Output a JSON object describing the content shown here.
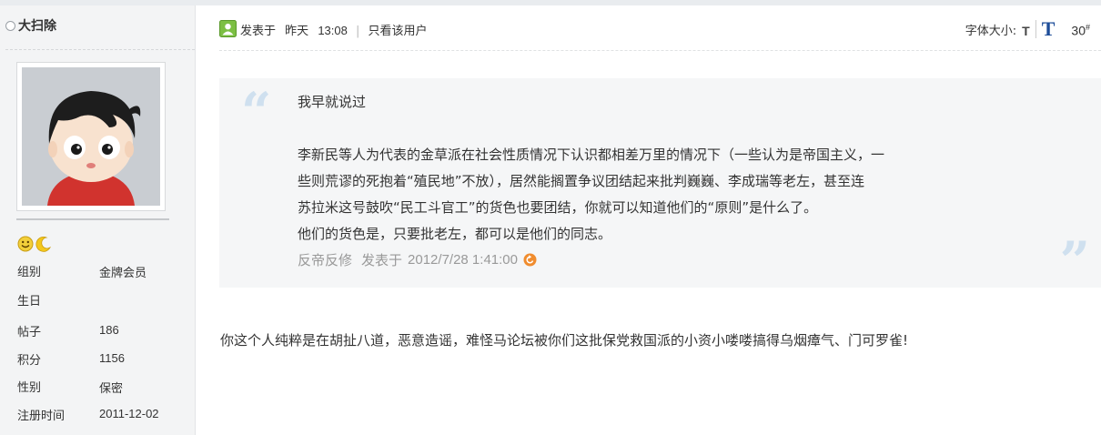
{
  "user": {
    "name": "大扫除",
    "fields": [
      {
        "label": "组别",
        "value": "金牌会员"
      },
      {
        "label": "生日",
        "value": ""
      },
      {
        "label": "帖子",
        "value": "186"
      },
      {
        "label": "积分",
        "value": "1156"
      },
      {
        "label": "性别",
        "value": "保密"
      },
      {
        "label": "注册时间",
        "value": "2011-12-02"
      }
    ]
  },
  "post": {
    "posted_label": "发表于",
    "posted_date": "昨天",
    "posted_time": "13:08",
    "only_author_link": "只看该用户",
    "font_size_label": "字体大小:",
    "font_small_label": "T",
    "font_big_label": "T",
    "floor_number": "30",
    "floor_suffix": "#",
    "quote": {
      "first_line": "我早就说过",
      "lines": [
        "李新民等人为代表的金草派在社会性质情况下认识都相差万里的情况下（一些认为是帝国主义，一",
        "些则荒谬的死抱着“殖民地”不放），居然能搁置争议团结起来批判巍巍、李成瑞等老左，甚至连",
        "苏拉米这号鼓吹“民工斗官工”的货色也要团结，你就可以知道他们的“原则”是什么了。",
        "他们的货色是，只要批老左，都可以是他们的同志。"
      ],
      "author": "反帝反修",
      "author_posted_label": "发表于",
      "author_time": "2012/7/28 1:41:00"
    },
    "reply_text": "你这个人纯粹是在胡扯八道，恶意造谣，难怪马论坛被你们这批保党救国派的小资小喽喽搞得乌烟瘴气、门可罗雀!"
  },
  "colors": {
    "sidebar_bg": "#f3f4f5",
    "quote_bg": "#f5f6f7",
    "quote_mark": "#cfe0ef",
    "font_big_blue": "#1e4d99",
    "goto_icon_orange": "#f08c2e",
    "post_icon_green": "#6fb23a"
  },
  "icons": {
    "status": "online-status-circle",
    "medal_1": "smiley-medal-icon",
    "medal_2": "moon-medal-icon",
    "post": "user-post-icon",
    "goto": "goto-post-arrow-icon"
  }
}
